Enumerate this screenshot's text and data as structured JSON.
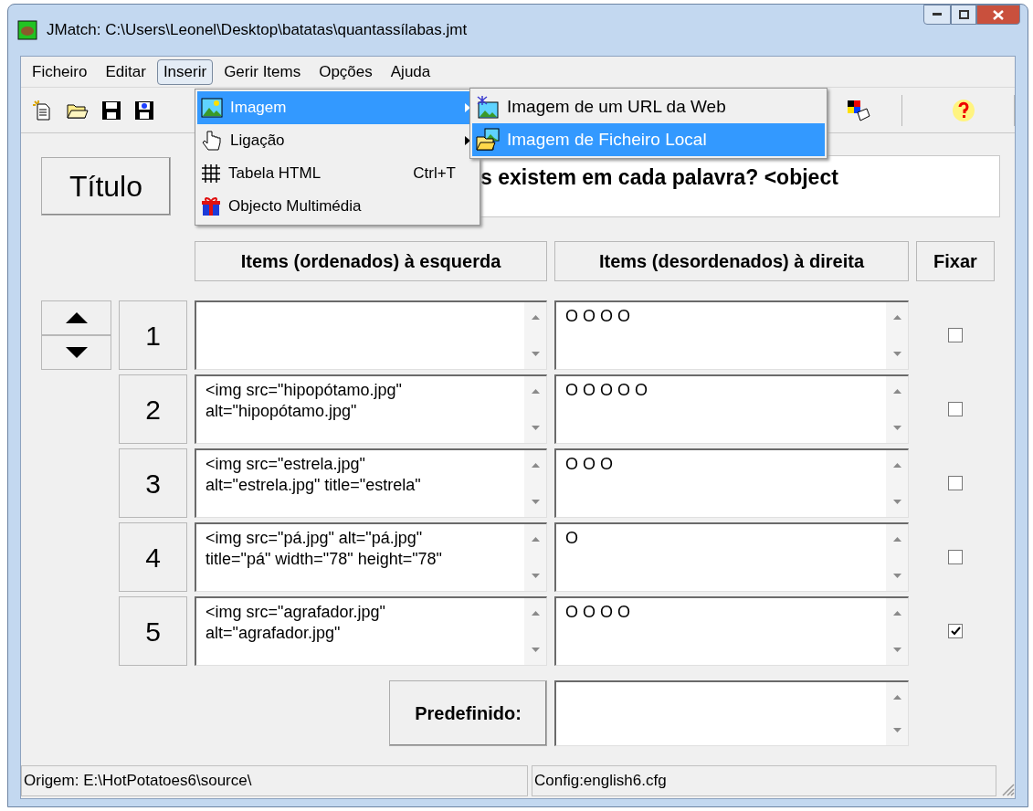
{
  "window": {
    "title": "JMatch: C:\\Users\\Leonel\\Desktop\\batatas\\quantassílabas.jmt"
  },
  "menu_bar": [
    {
      "label": "Ficheiro",
      "selected": false
    },
    {
      "label": "Editar",
      "selected": false
    },
    {
      "label": "Inserir",
      "selected": true
    },
    {
      "label": "Gerir Items",
      "selected": false
    },
    {
      "label": "Opções",
      "selected": false
    },
    {
      "label": "Ajuda",
      "selected": false
    }
  ],
  "insert_menu": [
    {
      "label": "Imagem",
      "has_submenu": true,
      "selected": true
    },
    {
      "label": "Ligação",
      "has_submenu": true,
      "selected": false
    },
    {
      "label": "Tabela HTML",
      "shortcut": "Ctrl+T",
      "has_submenu": false,
      "selected": false
    },
    {
      "label": "Objecto Multimédia",
      "has_submenu": false,
      "selected": false
    }
  ],
  "image_submenu": [
    {
      "label": "Imagem de um URL da Web",
      "selected": false
    },
    {
      "label": "Imagem de Ficheiro Local",
      "selected": true
    }
  ],
  "title_button": "Título",
  "title_field": {
    "value": "s existem em cada palavra? <object"
  },
  "columns": [
    "Items (ordenados) à esquerda",
    "Items (desordenados) à direita",
    "Fixar"
  ],
  "rows": [
    {
      "number": "1",
      "right": "O O O O",
      "fixed": false
    },
    {
      "number": "2",
      "left": "<img src=\"hipopótamo.jpg\"\nalt=\"hipopótamo.jpg\"",
      "right": "O O O O O",
      "fixed": false
    },
    {
      "number": "3",
      "left": "<img src=\"estrela.jpg\"\nalt=\"estrela.jpg\" title=\"estrela\"",
      "right": "O O O",
      "fixed": false
    },
    {
      "number": "4",
      "left": "<img src=\"pá.jpg\" alt=\"pá.jpg\"\ntitle=\"pá\" width=\"78\" height=\"78\"",
      "right": "O",
      "fixed": false
    },
    {
      "number": "5",
      "left": "<img src=\"agrafador.jpg\"\nalt=\"agrafador.jpg\"",
      "right": "O O O O",
      "fixed": true
    }
  ],
  "default_button": "Predefinido:",
  "status_bar": [
    "Origem: E:\\HotPotatoes6\\source\\",
    "Config:english6.cfg"
  ]
}
